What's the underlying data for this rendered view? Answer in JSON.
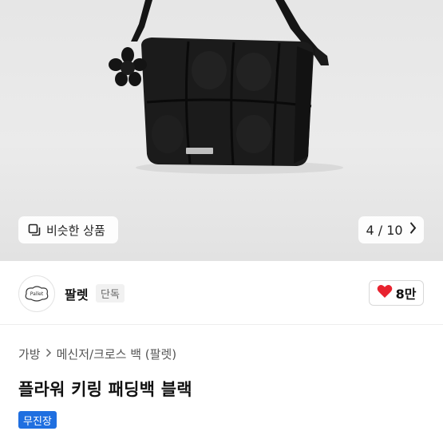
{
  "gallery": {
    "similar_label": "비슷한 상품",
    "similar_icon": "similar-products-icon",
    "current": "4",
    "separator": "/",
    "total": "10",
    "next_icon": "chevron-right-icon"
  },
  "seller": {
    "logo_text": "Pallet",
    "name": "팔렛",
    "badge": "단독"
  },
  "like": {
    "icon": "heart-icon",
    "color": "#e8232f",
    "count": "8만"
  },
  "breadcrumb": {
    "items": [
      "가방",
      "메신저/크로스 백 (팔렛)"
    ],
    "separator_icon": "chevron-right-icon"
  },
  "product": {
    "title": "플라워 키링 패딩백 블랙",
    "tag": "무진장",
    "tag_color": "#1f6fe0"
  }
}
